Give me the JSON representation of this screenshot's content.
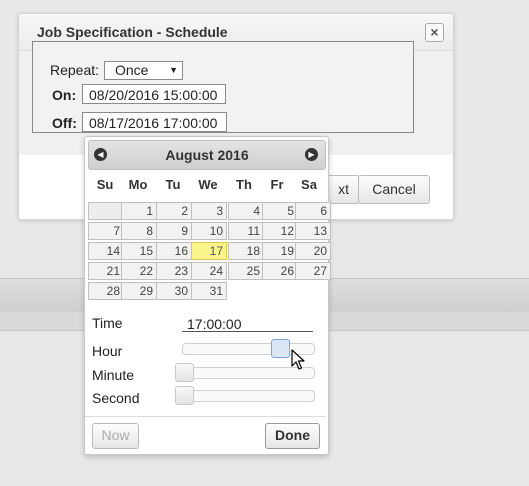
{
  "dialog": {
    "title": "Job Specification - Schedule",
    "close_icon": "close-icon",
    "repeat_label": "Repeat:",
    "repeat_value": "Once",
    "on_label": "On:",
    "on_value": "08/20/2016 15:00:00",
    "off_label": "Off:",
    "off_value": "08/17/2016 17:00:00",
    "next_partial": "xt",
    "cancel_label": "Cancel"
  },
  "datepicker": {
    "prev_icon": "prev-month-icon",
    "next_icon": "next-month-icon",
    "month_title": "August 2016",
    "weekdays": [
      "Su",
      "Mo",
      "Tu",
      "We",
      "Th",
      "Fr",
      "Sa"
    ],
    "weeks": [
      [
        "",
        "1",
        "2",
        "3",
        "4",
        "5",
        "6"
      ],
      [
        "7",
        "8",
        "9",
        "10",
        "11",
        "12",
        "13"
      ],
      [
        "14",
        "15",
        "16",
        "17",
        "18",
        "19",
        "20"
      ],
      [
        "21",
        "22",
        "23",
        "24",
        "25",
        "26",
        "27"
      ],
      [
        "28",
        "29",
        "30",
        "31",
        "",
        "",
        ""
      ]
    ],
    "highlighted_day": "17",
    "time_label": "Time",
    "time_value": "17:00:00",
    "hour_label": "Hour",
    "minute_label": "Minute",
    "second_label": "Second",
    "hour_value": 17,
    "minute_value": 0,
    "second_value": 0,
    "now_label": "Now",
    "done_label": "Done"
  }
}
